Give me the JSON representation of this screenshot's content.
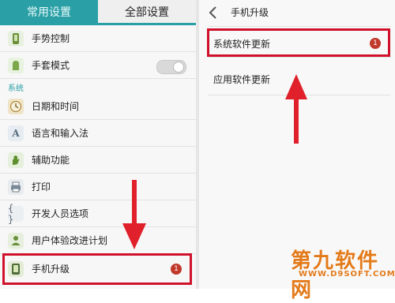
{
  "colors": {
    "accent": "#2aa0a6",
    "highlight": "#d0112b",
    "badge": "#c0392b",
    "arrow": "#e0202a",
    "watermark": "#e37a1a"
  },
  "left": {
    "tabs": [
      {
        "label": "常用设置",
        "active": false
      },
      {
        "label": "全部设置",
        "active": true
      }
    ],
    "section_label": "系统",
    "items": [
      {
        "label": "手势控制",
        "icon": "gesture-icon"
      },
      {
        "label": "手套模式",
        "icon": "glove-icon",
        "toggle": "off"
      },
      {
        "label": "日期和时间",
        "icon": "clock-icon"
      },
      {
        "label": "语言和输入法",
        "icon": "language-icon"
      },
      {
        "label": "辅助功能",
        "icon": "hand-icon"
      },
      {
        "label": "打印",
        "icon": "printer-icon"
      },
      {
        "label": "开发人员选项",
        "icon": "braces-icon"
      },
      {
        "label": "用户体验改进计划",
        "icon": "user-icon"
      },
      {
        "label": "手机升级",
        "icon": "phone-update-icon",
        "badge": "1"
      }
    ]
  },
  "right": {
    "title": "手机升级",
    "items": [
      {
        "label": "系统软件更新",
        "badge": "1"
      },
      {
        "label": "应用软件更新"
      }
    ]
  },
  "watermark": {
    "main": "第九软件网",
    "sub": "WWW.D9SOFT.COM"
  }
}
